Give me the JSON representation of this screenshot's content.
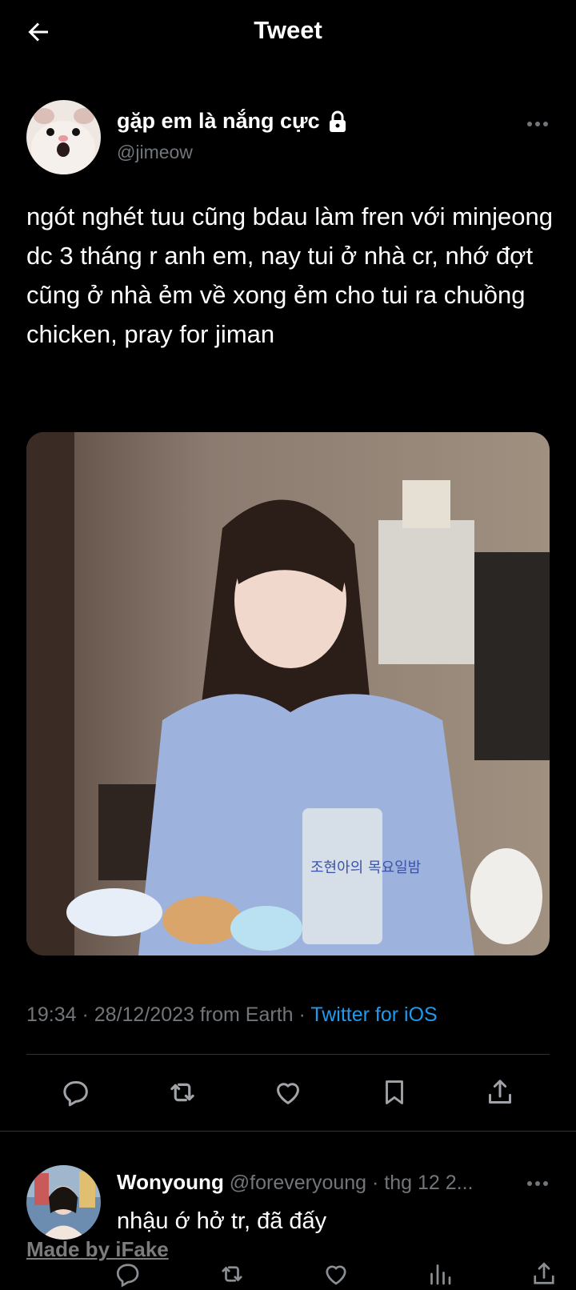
{
  "header": {
    "title": "Tweet",
    "back_icon": "arrow-left-icon"
  },
  "tweet": {
    "author": {
      "display_name": "gặp em là nắng cực",
      "handle": "@jimeow",
      "protected_icon": "lock-icon"
    },
    "text": "ngót nghét tuu cũng bdau làm fren với minjeong dc 3 tháng r anh em, nay tui ở nhà cr, nhớ đợt cũng ở nhà ẻm về xong ẻm cho tui ra chuồng chicken, pray for jiman",
    "timestamp": "19:34 · 28/12/2023",
    "location": " from Earth · ",
    "source": "Twitter for iOS",
    "actions": [
      "reply-icon",
      "retweet-icon",
      "like-icon",
      "bookmark-icon",
      "share-icon"
    ],
    "media_overlay_text": "조현아의 목요일밤"
  },
  "reply": {
    "display_name": "Wonyoung",
    "handle_and_time": " @foreveryoung · thg 12 2...",
    "text": "nhậu ớ hở tr, đã đấy",
    "actions": [
      "reply-icon",
      "retweet-icon",
      "like-icon",
      "views-icon",
      "share-icon"
    ]
  },
  "watermark": "Made by iFake",
  "colors": {
    "background": "#000000",
    "text": "#ffffff",
    "muted": "#71767b",
    "link": "#1d9bf0",
    "divider": "#2f3336"
  }
}
